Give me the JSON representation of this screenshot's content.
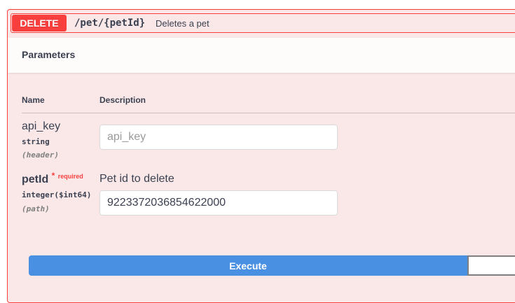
{
  "operation": {
    "method": "DELETE",
    "path": "/pet/{petId}",
    "summary": "Deletes a pet"
  },
  "parameters_section": {
    "title": "Parameters",
    "columns": [
      "Name",
      "Description"
    ]
  },
  "parameters": [
    {
      "name": "api_key",
      "type": "string",
      "location": "(header)",
      "required": false,
      "input_value": "",
      "input_placeholder": "api_key"
    },
    {
      "name": "petId",
      "required_star": "*",
      "required_label": "required",
      "type": "integer($int64)",
      "location": "(path)",
      "description": "Pet id to delete",
      "input_value": "9223372036854622000"
    }
  ],
  "actions": {
    "execute_label": "Execute"
  },
  "colors": {
    "delete_accent": "#f93e3e",
    "panel_bg": "#fae8e8",
    "execute_bg": "#4990e2"
  }
}
